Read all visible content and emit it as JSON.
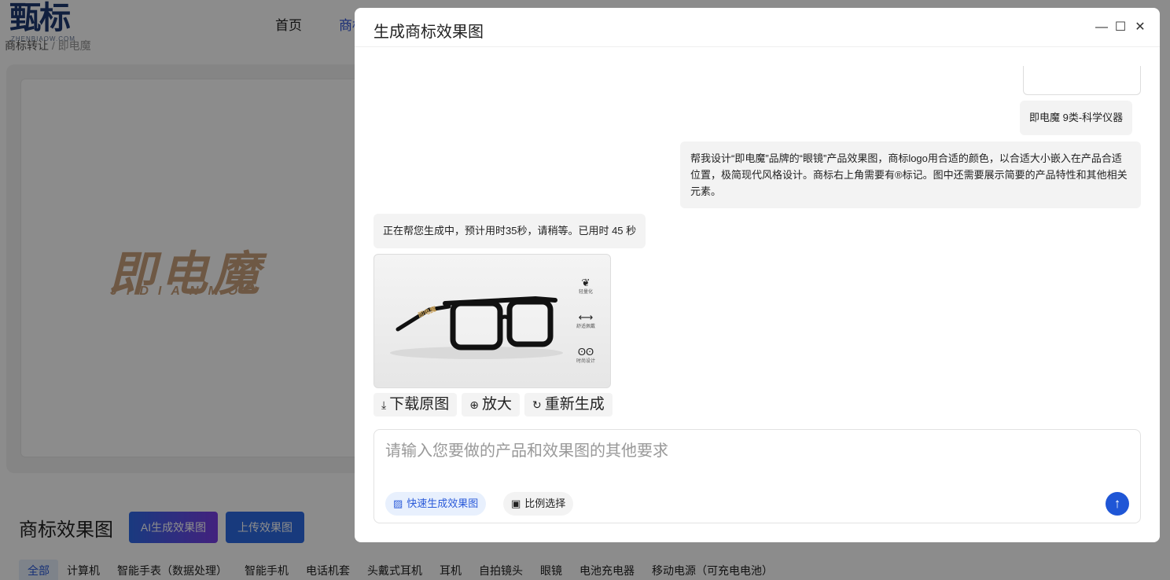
{
  "background": {
    "logo": {
      "main": "甄标",
      "sub": "ZHENBIAOW.COM"
    },
    "nav": {
      "home": "首页",
      "active_partial": "商标"
    },
    "breadcrumb": {
      "first": "商标转让",
      "sep": "/",
      "current": "即电魔"
    },
    "preview": {
      "brand_cn": "即电魔",
      "brand_pinyin": "JIDIANMO"
    },
    "section_title": "商标效果图",
    "ai_button": "AI生成效果图",
    "upload_button": "上传效果图",
    "categories": [
      "全部",
      "计算机",
      "智能手表（数据处理）",
      "智能手机",
      "电话机套",
      "头戴式耳机",
      "耳机",
      "自拍镜头",
      "眼镜",
      "电池充电器",
      "移动电源（可充电电池）"
    ],
    "active_category": "全部"
  },
  "modal": {
    "title": "生成商标效果图",
    "window_buttons": {
      "minimize": "—",
      "maximize": "☐",
      "close": "✕"
    },
    "messages": {
      "user_tag": "即电魔 9类-科学仪器",
      "user_prompt": "帮我设计“即电魔”品牌的“眼镜”产品效果图，商标logo用合适的颜色，以合适大小嵌入在产品合适位置，极简现代风格设计。商标右上角需要有®标记。图中还需要展示简要的产品特性和其他相关元素。",
      "bot_status": "正在帮您生成中，预计用时35秒，请稍等。已用时 45 秒"
    },
    "image": {
      "temple_brand": "即电魔",
      "features": [
        {
          "icon": "feather-icon",
          "label": "轻量化"
        },
        {
          "icon": "arrows-icon",
          "label": "舒适佩戴"
        },
        {
          "icon": "glasses-icon",
          "label": "时尚设计"
        }
      ]
    },
    "actions": {
      "download": "下载原图",
      "zoom": "放大",
      "regenerate": "重新生成"
    },
    "input": {
      "placeholder": "请输入您要做的产品和效果图的其他要求",
      "value": "",
      "quick_chip": "快速生成效果图",
      "ratio_chip": "比例选择"
    },
    "colors": {
      "accent": "#1f56d6",
      "chip_bg": "#e8f0fd"
    }
  }
}
